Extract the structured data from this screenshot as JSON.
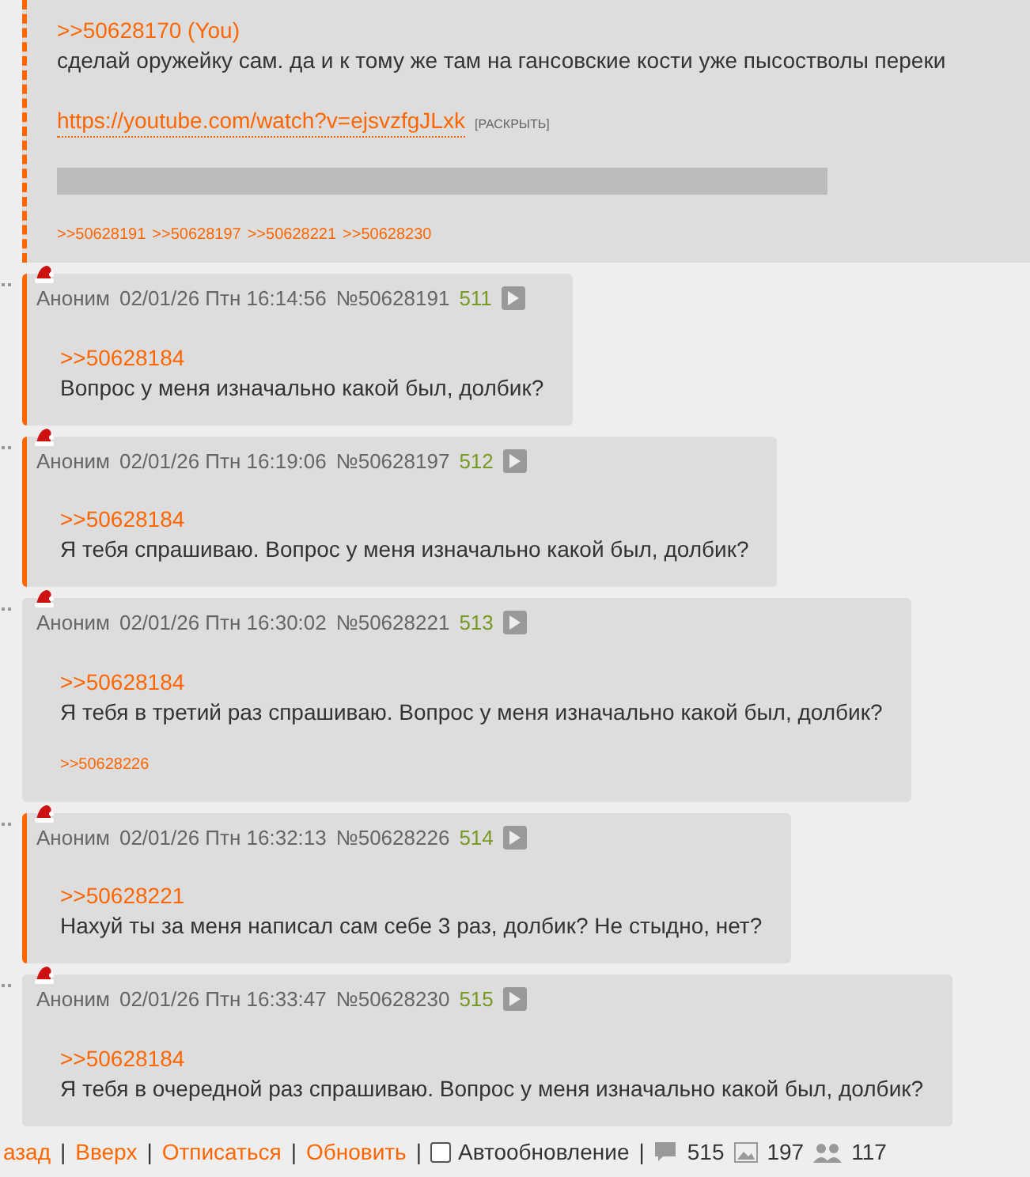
{
  "op_post": {
    "reply_link": ">>50628170 (You)",
    "text": "сделай оружейку сам. да и к тому же там на гансовские кости уже пысостволы переки",
    "url": "https://youtube.com/watch?v=ejsvzfgJLxk",
    "expand": "[РАСКРЫТЬ]",
    "replies": [
      ">>50628191",
      ">>50628197",
      ">>50628221",
      ">>50628230"
    ]
  },
  "posts": [
    {
      "name": "Аноним",
      "date": "02/01/26 Птн 16:14:56",
      "number": "№50628191",
      "index": "511",
      "highlighted": true,
      "reply_link": ">>50628184",
      "text": "Вопрос у меня изначально какой был, долбик?"
    },
    {
      "name": "Аноним",
      "date": "02/01/26 Птн 16:19:06",
      "number": "№50628197",
      "index": "512",
      "highlighted": true,
      "reply_link": ">>50628184",
      "text": "Я тебя спрашиваю. Вопрос у меня изначально какой был, долбик?"
    },
    {
      "name": "Аноним",
      "date": "02/01/26 Птн 16:30:02",
      "number": "№50628221",
      "index": "513",
      "highlighted": false,
      "reply_link": ">>50628184",
      "text": "Я тебя в третий раз спрашиваю. Вопрос у меня изначально какой был, долбик?",
      "replies": [
        ">>50628226"
      ]
    },
    {
      "name": "Аноним",
      "date": "02/01/26 Птн 16:32:13",
      "number": "№50628226",
      "index": "514",
      "highlighted": true,
      "reply_link": ">>50628221",
      "text": "Нахуй ты за меня написал сам себе 3 раз, долбик? Не стыдно, нет?"
    },
    {
      "name": "Аноним",
      "date": "02/01/26 Птн 16:33:47",
      "number": "№50628230",
      "index": "515",
      "highlighted": false,
      "reply_link": ">>50628184",
      "text": "Я тебя в очередной раз спрашиваю. Вопрос у меня изначально какой был, долбик?"
    }
  ],
  "footer": [
    {
      "kind": "link",
      "text": "азад"
    },
    {
      "kind": "separator",
      "text": "|"
    },
    {
      "kind": "link",
      "text": "Вверх"
    },
    {
      "kind": "separator",
      "text": "|"
    },
    {
      "kind": "link",
      "text": "Отписаться"
    },
    {
      "kind": "separator",
      "text": "|"
    },
    {
      "kind": "link",
      "text": "Обновить"
    },
    {
      "kind": "separator",
      "text": "|"
    },
    {
      "kind": "checkbox",
      "text": "Автообновление",
      "checked": false
    },
    {
      "kind": "separator",
      "text": "|"
    },
    {
      "kind": "posts",
      "text": "515"
    },
    {
      "kind": "images",
      "text": "197"
    },
    {
      "kind": "posters",
      "text": "117"
    }
  ]
}
